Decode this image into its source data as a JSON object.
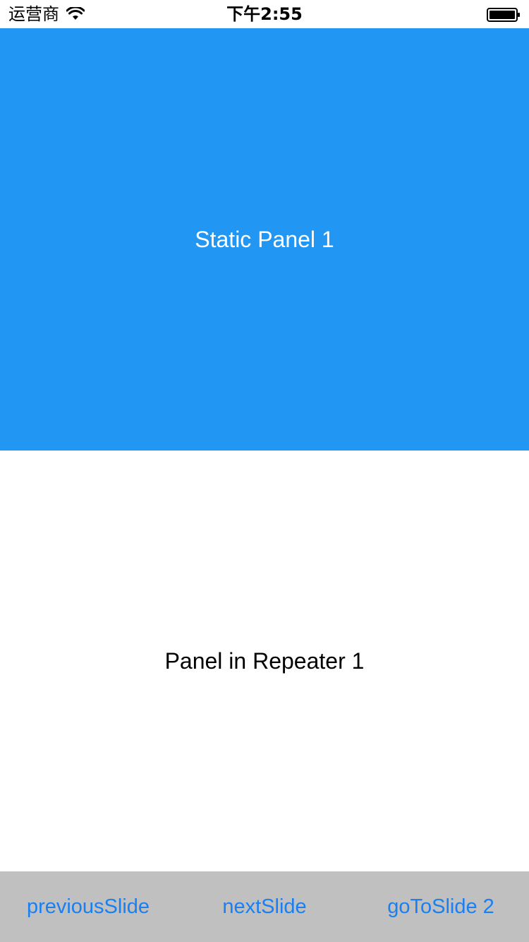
{
  "status_bar": {
    "carrier": "运营商",
    "time": "下午2:55",
    "wifi_icon": "wifi-icon",
    "battery_icon": "battery-icon"
  },
  "panels": {
    "static_label": "Static Panel 1",
    "repeater_label": "Panel in Repeater 1"
  },
  "toolbar": {
    "previous_label": "previousSlide",
    "next_label": "nextSlide",
    "goto_label": "goToSlide 2"
  },
  "colors": {
    "static_panel_bg": "#2196F3",
    "button_text": "#1a7ff0",
    "toolbar_bg": "#c0c0c0"
  }
}
